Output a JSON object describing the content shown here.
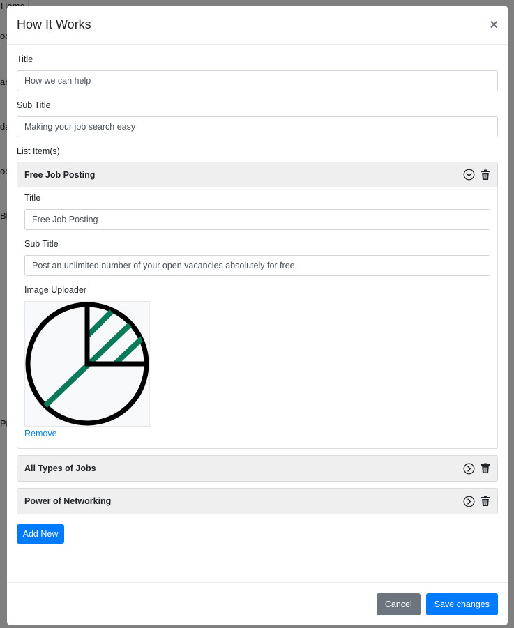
{
  "background": {
    "fragments": [
      "Home",
      "oc",
      "an",
      "da",
      "oc",
      "Bl",
      "Pi"
    ]
  },
  "modal": {
    "title": "How It Works",
    "close_symbol": "×",
    "title_label": "Title",
    "title_value": "How we can help",
    "subtitle_label": "Sub Title",
    "subtitle_value": "Making your job search easy",
    "list_label": "List Item(s)",
    "items": [
      {
        "heading": "Free Job Posting",
        "expanded": true,
        "title_label": "Title",
        "title_value": "Free Job Posting",
        "subtitle_label": "Sub Title",
        "subtitle_value": "Post an unlimited number of your open vacancies absolutely for free.",
        "image_label": "Image Uploader",
        "image_icon": "pie-chart-icon",
        "remove_label": "Remove"
      },
      {
        "heading": "All Types of Jobs",
        "expanded": false
      },
      {
        "heading": "Power of Networking",
        "expanded": false
      }
    ],
    "add_new_label": "Add New",
    "cancel_label": "Cancel",
    "save_label": "Save changes"
  },
  "colors": {
    "primary": "#007bff",
    "secondary": "#6c757d",
    "accent_green": "#0b7a5a",
    "link": "#0b84e0"
  }
}
